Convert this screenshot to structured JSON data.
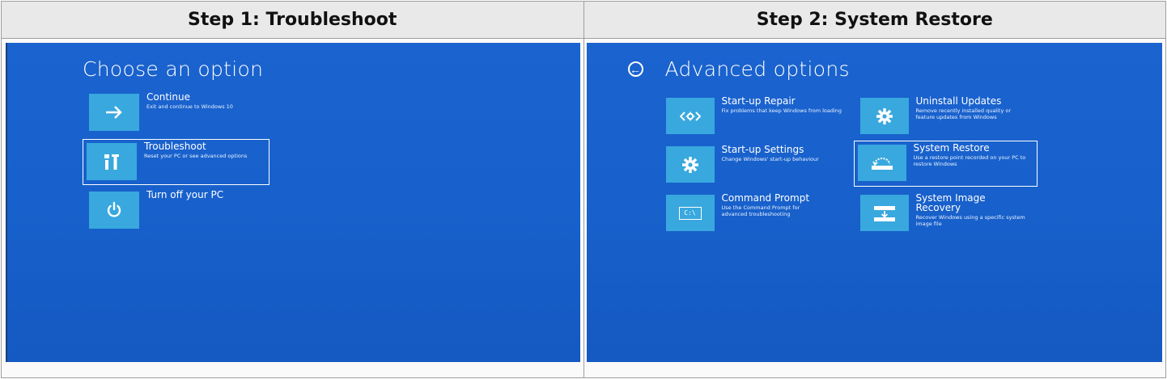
{
  "steps": [
    {
      "title": "Step 1: Troubleshoot",
      "screen": {
        "title": "Choose an option",
        "options": [
          {
            "label": "Continue",
            "desc": "Exit and continue to Windows 10",
            "icon": "arrow-right-icon"
          },
          {
            "label": "Troubleshoot",
            "desc": "Reset your PC or see advanced options",
            "icon": "tools-icon",
            "selected": true
          },
          {
            "label": "Turn off your PC",
            "desc": "",
            "icon": "power-icon"
          }
        ]
      }
    },
    {
      "title": "Step 2: System Restore",
      "screen": {
        "title": "Advanced options",
        "back_icon": "back-arrow-icon",
        "options": [
          {
            "label": "Start-up Repair",
            "desc": "Fix problems that keep Windows from loading",
            "icon": "startup-repair-icon"
          },
          {
            "label": "Uninstall Updates",
            "desc": "Remove recently installed quality or feature updates from Windows",
            "icon": "gear-icon"
          },
          {
            "label": "Start-up Settings",
            "desc": "Change Windows' start-up behaviour",
            "icon": "gear-icon"
          },
          {
            "label": "System Restore",
            "desc": "Use a restore point recorded on your PC to restore Windows",
            "icon": "system-restore-icon",
            "selected": true
          },
          {
            "label": "Command Prompt",
            "desc": "Use the Command Prompt for advanced troubleshooting",
            "icon": "command-prompt-icon",
            "icon_text": "C:\\"
          },
          {
            "label": "System Image Recovery",
            "desc": "Recover Windows using a specific system image file",
            "icon": "system-image-icon"
          }
        ]
      }
    }
  ],
  "colors": {
    "screen_blue": "#1861cc",
    "tile_blue": "#39a8de",
    "header_gray": "#e9e9e9"
  }
}
